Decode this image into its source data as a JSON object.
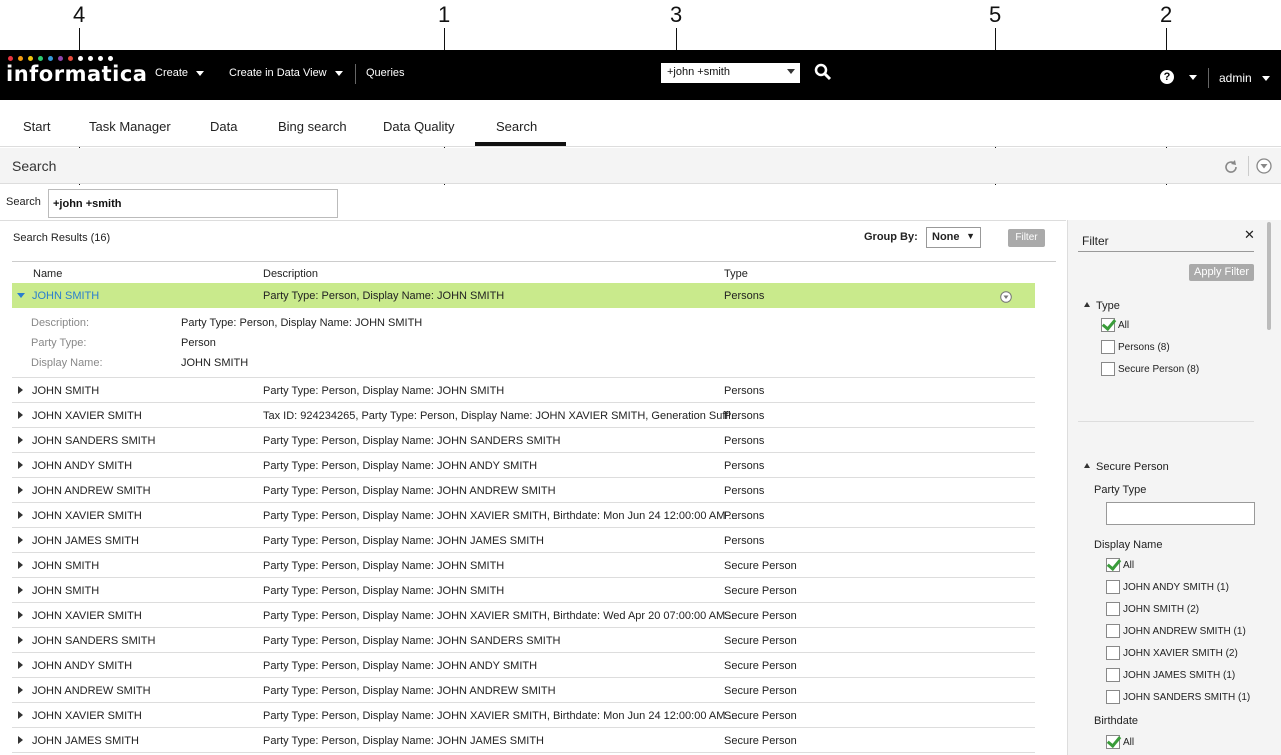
{
  "callouts": [
    "4",
    "1",
    "3",
    "5",
    "2"
  ],
  "topbar": {
    "logo": "informatica",
    "menus": [
      "Create",
      "Create in Data View",
      "Queries"
    ],
    "search_value": "+john +smith",
    "user": "admin"
  },
  "tabs": [
    "Start",
    "Task Manager",
    "Data",
    "Bing search",
    "Data Quality",
    "Search"
  ],
  "search": {
    "title": "Search",
    "label": "Search",
    "query": "+john +smith"
  },
  "results": {
    "count_label": "Search Results (16)",
    "group_by_label": "Group By:",
    "group_by_value": "None",
    "filter_button": "Filter",
    "columns": [
      "Name",
      "Description",
      "Type"
    ],
    "selected": {
      "name": "JOHN SMITH",
      "description": "Party Type: Person, Display Name: JOHN SMITH",
      "type": "Persons",
      "details": [
        {
          "key": "Description:",
          "value": "Party Type: Person, Display Name: JOHN SMITH"
        },
        {
          "key": "Party Type:",
          "value": "Person"
        },
        {
          "key": "Display Name:",
          "value": "JOHN SMITH"
        }
      ]
    },
    "rows": [
      {
        "name": "JOHN SMITH",
        "description": "Party Type: Person, Display Name: JOHN SMITH",
        "type": "Persons"
      },
      {
        "name": "JOHN XAVIER SMITH",
        "description": "Tax ID: 924234265, Party Type: Person, Display Name: JOHN XAVIER SMITH, Generation Suffi...",
        "type": "Persons"
      },
      {
        "name": "JOHN SANDERS SMITH",
        "description": "Party Type: Person, Display Name: JOHN SANDERS SMITH",
        "type": "Persons"
      },
      {
        "name": "JOHN ANDY SMITH",
        "description": "Party Type: Person, Display Name: JOHN ANDY SMITH",
        "type": "Persons"
      },
      {
        "name": "JOHN ANDREW SMITH",
        "description": "Party Type: Person, Display Name: JOHN ANDREW SMITH",
        "type": "Persons"
      },
      {
        "name": "JOHN XAVIER SMITH",
        "description": "Party Type: Person, Display Name: JOHN XAVIER SMITH, Birthdate: Mon Jun 24 12:00:00 AM ...",
        "type": "Persons"
      },
      {
        "name": "JOHN JAMES SMITH",
        "description": "Party Type: Person, Display Name: JOHN JAMES SMITH",
        "type": "Persons"
      },
      {
        "name": "JOHN SMITH",
        "description": "Party Type: Person, Display Name: JOHN SMITH",
        "type": "Secure Person"
      },
      {
        "name": "JOHN SMITH",
        "description": "Party Type: Person, Display Name: JOHN SMITH",
        "type": "Secure Person"
      },
      {
        "name": "JOHN XAVIER SMITH",
        "description": "Party Type: Person, Display Name: JOHN XAVIER SMITH, Birthdate: Wed Apr 20 07:00:00 AM...",
        "type": "Secure Person"
      },
      {
        "name": "JOHN SANDERS SMITH",
        "description": "Party Type: Person, Display Name: JOHN SANDERS SMITH",
        "type": "Secure Person"
      },
      {
        "name": "JOHN ANDY SMITH",
        "description": "Party Type: Person, Display Name: JOHN ANDY SMITH",
        "type": "Secure Person"
      },
      {
        "name": "JOHN ANDREW SMITH",
        "description": "Party Type: Person, Display Name: JOHN ANDREW SMITH",
        "type": "Secure Person"
      },
      {
        "name": "JOHN XAVIER SMITH",
        "description": "Party Type: Person, Display Name: JOHN XAVIER SMITH, Birthdate: Mon Jun 24 12:00:00 AM ...",
        "type": "Secure Person"
      },
      {
        "name": "JOHN JAMES SMITH",
        "description": "Party Type: Person, Display Name: JOHN JAMES SMITH",
        "type": "Secure Person"
      }
    ]
  },
  "filter": {
    "title": "Filter",
    "apply": "Apply Filter",
    "type_section": "Type",
    "type_options": [
      {
        "label": "All",
        "checked": true
      },
      {
        "label": "Persons (8)",
        "checked": false
      },
      {
        "label": "Secure Person (8)",
        "checked": false
      }
    ],
    "secure_section": "Secure Person",
    "party_type_label": "Party Type",
    "display_name_label": "Display Name",
    "display_name_options": [
      {
        "label": "All",
        "checked": true
      },
      {
        "label": "JOHN ANDY SMITH (1)",
        "checked": false
      },
      {
        "label": "JOHN SMITH (2)",
        "checked": false
      },
      {
        "label": "JOHN ANDREW SMITH (1)",
        "checked": false
      },
      {
        "label": "JOHN XAVIER SMITH (2)",
        "checked": false
      },
      {
        "label": "JOHN JAMES SMITH (1)",
        "checked": false
      },
      {
        "label": "JOHN SANDERS SMITH (1)",
        "checked": false
      }
    ],
    "birthdate_label": "Birthdate",
    "birthdate_options": [
      {
        "label": "All",
        "checked": true
      }
    ]
  },
  "colors": {
    "selected_row": "#c9ea8c",
    "link_blue": "#2a7ecf",
    "topbar": "#000000"
  }
}
